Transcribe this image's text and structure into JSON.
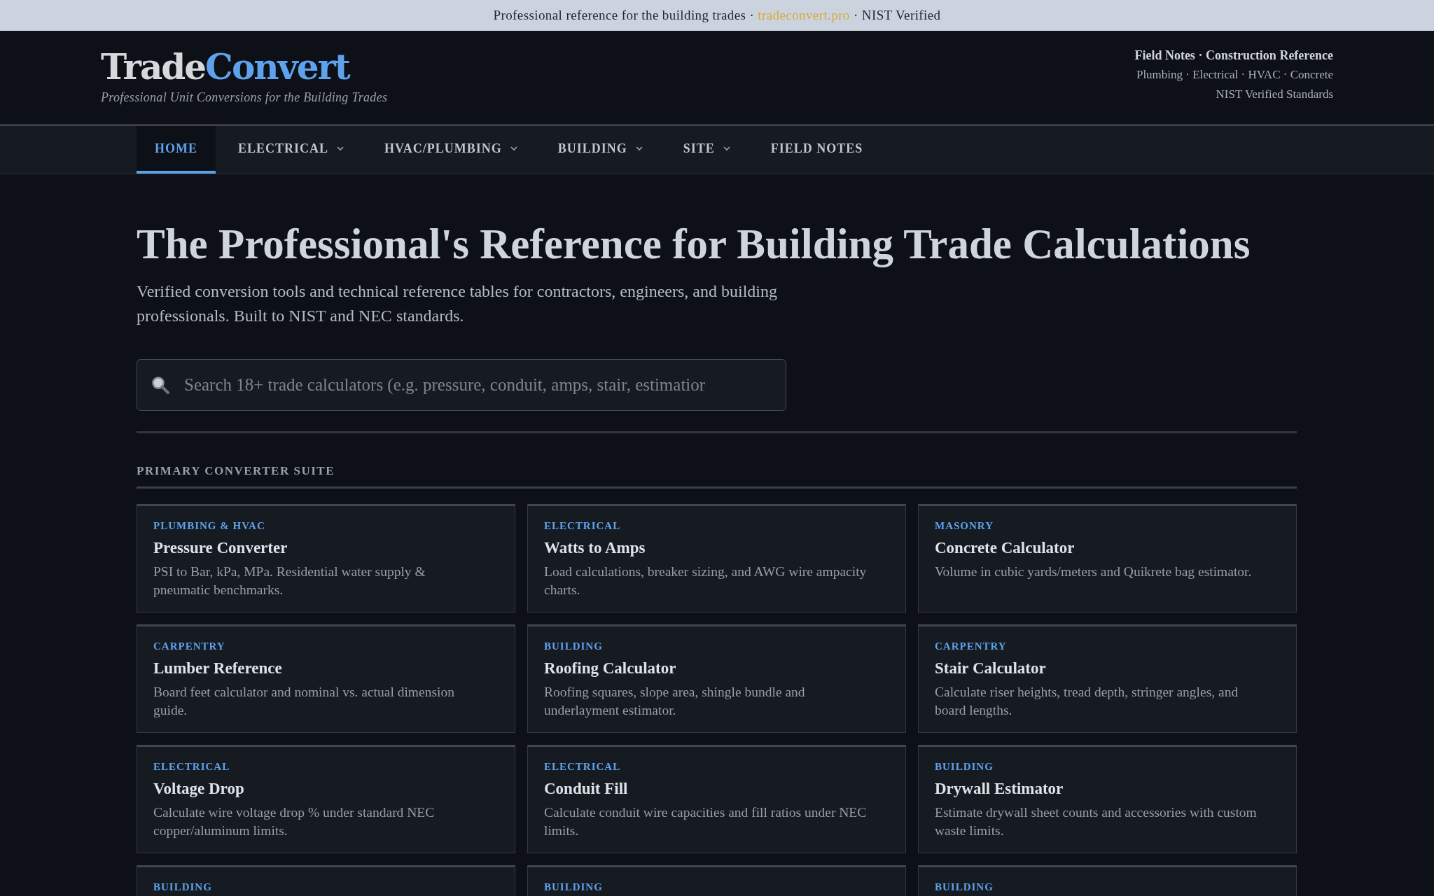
{
  "top_banner": {
    "before": "Professional reference for the building trades · ",
    "link": "tradeconvert.pro",
    "after": " · NIST Verified"
  },
  "header": {
    "logo_first": "Trade",
    "logo_second": "Convert",
    "tagline": "Professional Unit Conversions for the Building Trades",
    "right_lines": [
      "Field Notes · Construction Reference",
      "Plumbing · Electrical · HVAC · Concrete",
      "NIST Verified Standards"
    ]
  },
  "nav": [
    {
      "label": "HOME",
      "selected": true,
      "dropdown": false
    },
    {
      "label": "ELECTRICAL",
      "selected": false,
      "dropdown": true
    },
    {
      "label": "HVAC/PLUMBING",
      "selected": false,
      "dropdown": true
    },
    {
      "label": "BUILDING",
      "selected": false,
      "dropdown": true
    },
    {
      "label": "SITE",
      "selected": false,
      "dropdown": true
    },
    {
      "label": "FIELD NOTES",
      "selected": false,
      "dropdown": false
    }
  ],
  "hero": {
    "title": "The Professional's Reference for Building Trade Calculations",
    "subtitle": "Verified conversion tools and technical reference tables for contractors, engineers, and building professionals. Built to NIST and NEC standards."
  },
  "search": {
    "placeholder": "Search 18+ trade calculators (e.g. pressure, conduit, amps, stair, estimatior"
  },
  "section": {
    "heading": "PRIMARY CONVERTER SUITE"
  },
  "cards": [
    {
      "category": "PLUMBING & HVAC",
      "title": "Pressure Converter",
      "description": "PSI to Bar, kPa, MPa. Residential water supply & pneumatic benchmarks."
    },
    {
      "category": "ELECTRICAL",
      "title": "Watts to Amps",
      "description": "Load calculations, breaker sizing, and AWG wire ampacity charts."
    },
    {
      "category": "MASONRY",
      "title": "Concrete Calculator",
      "description": "Volume in cubic yards/meters and Quikrete bag estimator."
    },
    {
      "category": "CARPENTRY",
      "title": "Lumber Reference",
      "description": "Board feet calculator and nominal vs. actual dimension guide."
    },
    {
      "category": "BUILDING",
      "title": "Roofing Calculator",
      "description": "Roofing squares, slope area, shingle bundle and underlayment estimator."
    },
    {
      "category": "CARPENTRY",
      "title": "Stair Calculator",
      "description": "Calculate riser heights, tread depth, stringer angles, and board lengths."
    },
    {
      "category": "ELECTRICAL",
      "title": "Voltage Drop",
      "description": "Calculate wire voltage drop % under standard NEC copper/aluminum limits."
    },
    {
      "category": "ELECTRICAL",
      "title": "Conduit Fill",
      "description": "Calculate conduit wire capacities and fill ratios under NEC limits."
    },
    {
      "category": "BUILDING",
      "title": "Drywall Estimator",
      "description": "Estimate drywall sheet counts and accessories with custom waste limits."
    },
    {
      "category": "BUILDING"
    },
    {
      "category": "BUILDING"
    },
    {
      "category": "BUILDING"
    }
  ]
}
